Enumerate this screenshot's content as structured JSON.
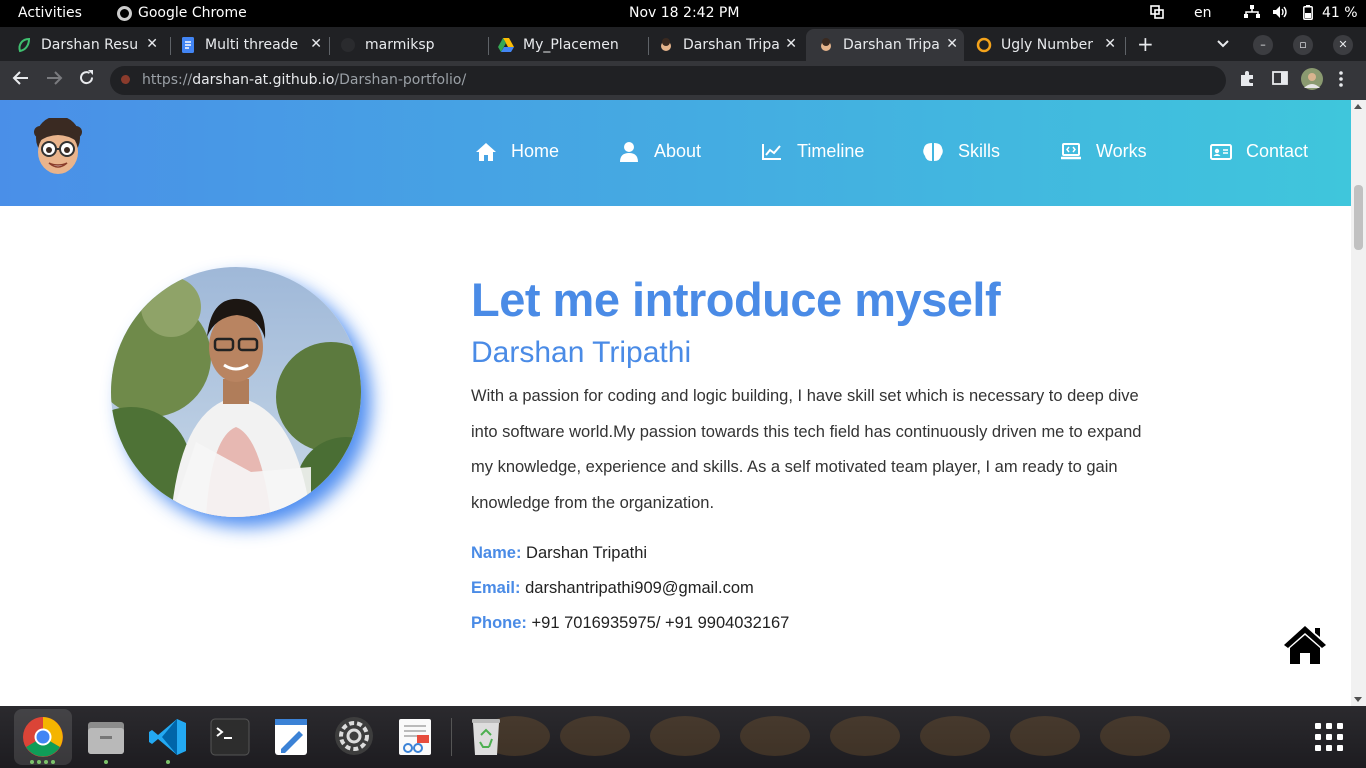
{
  "system_bar": {
    "activities": "Activities",
    "app_name": "Google Chrome",
    "clock": "Nov 18  2:42 PM",
    "language": "en",
    "battery": "41 %"
  },
  "tabs": [
    {
      "label": "Darshan Resu"
    },
    {
      "label": "Multi threade"
    },
    {
      "label": "marmiksp"
    },
    {
      "label": "My_Placemen"
    },
    {
      "label": "Darshan Tripa"
    },
    {
      "label": "Darshan Tripa"
    },
    {
      "label": "Ugly Number"
    }
  ],
  "omnibox": {
    "scheme": "https://",
    "host": "darshan-at.github.io",
    "path": "/Darshan-portfolio/"
  },
  "nav": {
    "home": "Home",
    "about": "About",
    "timeline": "Timeline",
    "skills": "Skills",
    "works": "Works",
    "contact": "Contact"
  },
  "about": {
    "heading": "Let me introduce myself",
    "name": "Darshan Tripathi",
    "paragraph": "With a passion for coding and logic building, I have skill set which is necessary to deep dive into software world.My passion towards this tech field has continuously driven me to expand my knowledge, experience and skills. As a self motivated team player, I am ready to gain knowledge from the organization.",
    "name_label": "Name:",
    "name_value": "Darshan Tripathi",
    "email_label": "Email:",
    "email_value": "darshantripathi909@gmail.com",
    "phone_label": "Phone:",
    "phone_value": "+91 7016935975/ +91 9904032167"
  },
  "colors": {
    "accent": "#4a8be6",
    "header_gradient_start": "#4a8fe8",
    "header_gradient_end": "#3fc6dc"
  }
}
